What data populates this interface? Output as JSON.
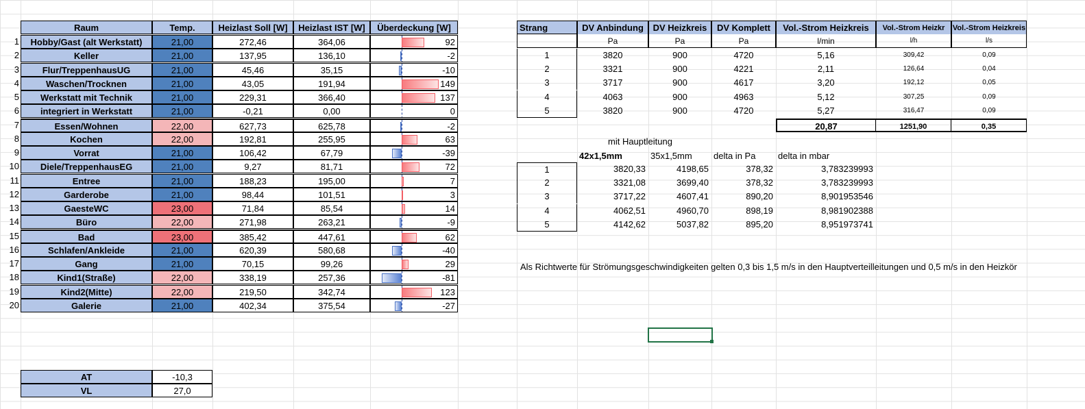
{
  "left_table": {
    "headers": {
      "room": "Raum",
      "temp": "Temp.",
      "soll": "Heizlast Soll [W]",
      "ist": "Heizlast IST [W]",
      "ueber": "Überdeckung [W]"
    },
    "rows": [
      {
        "n": "1",
        "room": "Hobby/Gast (alt Werkstatt)",
        "temp": "21,00",
        "tcol": "blue",
        "soll": "272,46",
        "ist": "364,06",
        "ueber": "92",
        "v": 92
      },
      {
        "n": "2",
        "room": "Keller",
        "temp": "21,00",
        "tcol": "blue",
        "soll": "137,95",
        "ist": "136,10",
        "ueber": "-2",
        "v": -2
      },
      {
        "n": "3",
        "room": "Flur/TreppenhausUG",
        "temp": "21,00",
        "tcol": "blue",
        "soll": "45,46",
        "ist": "35,15",
        "ueber": "-10",
        "v": -10
      },
      {
        "n": "4",
        "room": "Waschen/Trocknen",
        "temp": "21,00",
        "tcol": "blue",
        "soll": "43,05",
        "ist": "191,94",
        "ueber": "149",
        "v": 149
      },
      {
        "n": "5",
        "room": "Werkstatt mit Technik",
        "temp": "21,00",
        "tcol": "blue",
        "soll": "229,31",
        "ist": "366,40",
        "ueber": "137",
        "v": 137
      },
      {
        "n": "6",
        "room": "integriert in Werkstatt",
        "temp": "21,00",
        "tcol": "blue",
        "soll": "-0,21",
        "ist": "0,00",
        "ueber": "0",
        "v": 0
      },
      {
        "n": "7",
        "room": "Essen/Wohnen",
        "temp": "22,00",
        "tcol": "pink",
        "soll": "627,73",
        "ist": "625,78",
        "ueber": "-2",
        "v": -2
      },
      {
        "n": "8",
        "room": "Kochen",
        "temp": "22,00",
        "tcol": "pink",
        "soll": "192,81",
        "ist": "255,95",
        "ueber": "63",
        "v": 63
      },
      {
        "n": "9",
        "room": "Vorrat",
        "temp": "21,00",
        "tcol": "blue",
        "soll": "106,42",
        "ist": "67,79",
        "ueber": "-39",
        "v": -39
      },
      {
        "n": "10",
        "room": "Diele/TreppenhausEG",
        "temp": "21,00",
        "tcol": "blue",
        "soll": "9,27",
        "ist": "81,71",
        "ueber": "72",
        "v": 72
      },
      {
        "n": "11",
        "room": "Entree",
        "temp": "21,00",
        "tcol": "blue",
        "soll": "188,23",
        "ist": "195,00",
        "ueber": "7",
        "v": 7
      },
      {
        "n": "12",
        "room": "Garderobe",
        "temp": "21,00",
        "tcol": "blue",
        "soll": "98,44",
        "ist": "101,51",
        "ueber": "3",
        "v": 3
      },
      {
        "n": "13",
        "room": "GaesteWC",
        "temp": "23,00",
        "tcol": "red",
        "soll": "71,84",
        "ist": "85,54",
        "ueber": "14",
        "v": 14
      },
      {
        "n": "14",
        "room": "Büro",
        "temp": "22,00",
        "tcol": "pink",
        "soll": "271,98",
        "ist": "263,21",
        "ueber": "-9",
        "v": -9
      },
      {
        "n": "15",
        "room": "Bad",
        "temp": "23,00",
        "tcol": "red",
        "soll": "385,42",
        "ist": "447,61",
        "ueber": "62",
        "v": 62
      },
      {
        "n": "16",
        "room": "Schlafen/Ankleide",
        "temp": "21,00",
        "tcol": "blue",
        "soll": "620,39",
        "ist": "580,68",
        "ueber": "-40",
        "v": -40
      },
      {
        "n": "17",
        "room": "Gang",
        "temp": "21,00",
        "tcol": "blue",
        "soll": "70,15",
        "ist": "99,26",
        "ueber": "29",
        "v": 29
      },
      {
        "n": "18",
        "room": "Kind1(Straße)",
        "temp": "22,00",
        "tcol": "pink",
        "soll": "338,19",
        "ist": "257,36",
        "ueber": "-81",
        "v": -81
      },
      {
        "n": "19",
        "room": "Kind2(Mitte)",
        "temp": "22,00",
        "tcol": "pink",
        "soll": "219,50",
        "ist": "342,74",
        "ueber": "123",
        "v": 123
      },
      {
        "n": "20",
        "room": "Galerie",
        "temp": "21,00",
        "tcol": "blue",
        "soll": "402,34",
        "ist": "375,54",
        "ueber": "-27",
        "v": -27
      }
    ]
  },
  "at_vl": [
    {
      "label": "AT",
      "value": "-10,3"
    },
    {
      "label": "VL",
      "value": "27,0"
    }
  ],
  "strang_table": {
    "headers": [
      "Strang",
      "DV Anbindung",
      "DV Heizkreis",
      "DV Komplett",
      "Vol.-Strom Heizkreis",
      "Vol.-Strom Heizkr",
      "Vol.-Strom Heizkreis"
    ],
    "units": [
      "",
      "Pa",
      "Pa",
      "Pa",
      "l/min",
      "l/h",
      "l/s"
    ],
    "rows": [
      [
        "1",
        "3820",
        "900",
        "4720",
        "5,16",
        "309,42",
        "0,09"
      ],
      [
        "2",
        "3321",
        "900",
        "4221",
        "2,11",
        "126,64",
        "0,04"
      ],
      [
        "3",
        "3717",
        "900",
        "4617",
        "3,20",
        "192,12",
        "0,05"
      ],
      [
        "4",
        "4063",
        "900",
        "4963",
        "5,12",
        "307,25",
        "0,09"
      ],
      [
        "5",
        "3820",
        "900",
        "4720",
        "5,27",
        "316,47",
        "0,09"
      ]
    ],
    "totals": [
      "20,87",
      "1251,90",
      "0,35"
    ]
  },
  "hauptleitung": {
    "title": "mit Hauptleitung",
    "headers": [
      "42x1,5mm",
      "35x1,5mm",
      "delta in Pa",
      "delta in mbar"
    ],
    "rows": [
      [
        "1",
        "3820,33",
        "4198,65",
        "378,32",
        "3,783239993"
      ],
      [
        "2",
        "3321,08",
        "3699,40",
        "378,32",
        "3,783239993"
      ],
      [
        "3",
        "3717,22",
        "4607,41",
        "890,20",
        "8,901953546"
      ],
      [
        "4",
        "4062,51",
        "4960,70",
        "898,19",
        "8,981902388"
      ],
      [
        "5",
        "4142,62",
        "5037,82",
        "895,20",
        "8,951973741"
      ]
    ]
  },
  "note": "Als Richtwerte für Strömungsgeschwindigkeiten gelten 0,3 bis 1,5 m/s in den Hauptverteilleitungen und 0,5 m/s in den Heizkör"
}
